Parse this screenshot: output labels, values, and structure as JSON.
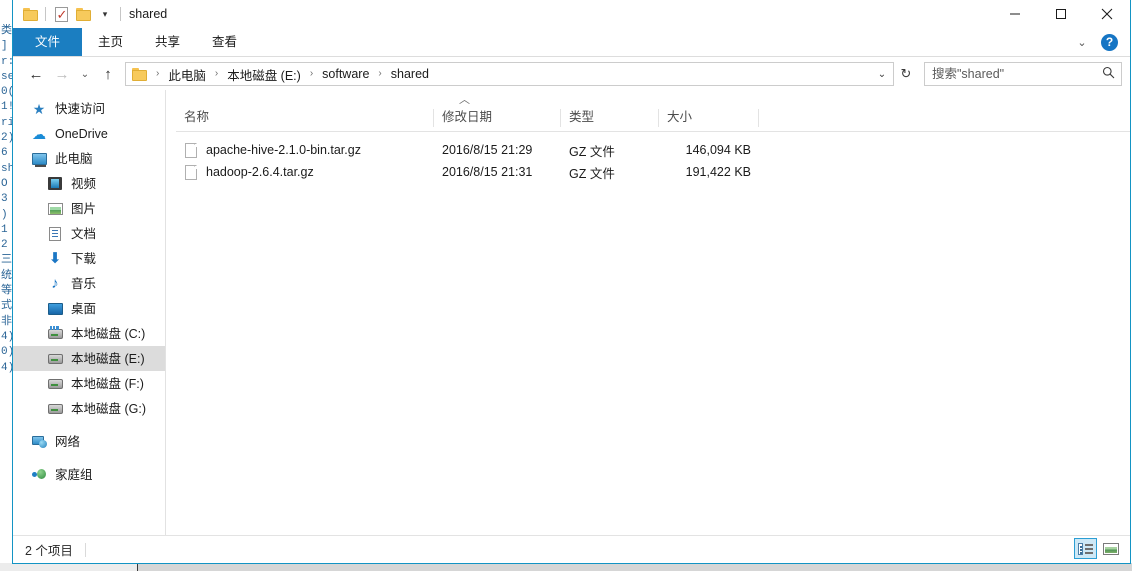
{
  "window": {
    "title": "shared",
    "quick_access": [
      {
        "name": "folder-icon",
        "label": "属性"
      },
      {
        "name": "properties-icon",
        "label": "属性"
      },
      {
        "name": "new-folder-icon",
        "label": "新建文件夹"
      }
    ],
    "controls": {
      "minimize": "—",
      "maximize": "□",
      "close": "✕"
    }
  },
  "ribbon": {
    "tabs": [
      {
        "label": "文件",
        "selected": true
      },
      {
        "label": "主页",
        "selected": false
      },
      {
        "label": "共享",
        "selected": false
      },
      {
        "label": "查看",
        "selected": false
      }
    ],
    "collapse_label": "⌄",
    "help_label": "?"
  },
  "address": {
    "back_label": "←",
    "forward_label": "→",
    "history_label": "⌄",
    "up_label": "↑",
    "crumbs": [
      "此电脑",
      "本地磁盘 (E:)",
      "software",
      "shared"
    ],
    "separator": "›",
    "dropdown_label": "⌄",
    "refresh_label": "↻"
  },
  "search": {
    "placeholder": "搜索\"shared\"",
    "value": "",
    "icon": "search-icon"
  },
  "sidebar": {
    "items": [
      {
        "label": "快速访问",
        "icon": "star-icon",
        "indent": false,
        "selected": false
      },
      {
        "label": "OneDrive",
        "icon": "cloud-icon",
        "indent": false,
        "selected": false
      },
      {
        "label": "此电脑",
        "icon": "monitor-icon",
        "indent": false,
        "selected": false
      },
      {
        "label": "视频",
        "icon": "video-icon",
        "indent": true,
        "selected": false
      },
      {
        "label": "图片",
        "icon": "picture-icon",
        "indent": true,
        "selected": false
      },
      {
        "label": "文档",
        "icon": "document-icon",
        "indent": true,
        "selected": false
      },
      {
        "label": "下载",
        "icon": "download-icon",
        "indent": true,
        "selected": false
      },
      {
        "label": "音乐",
        "icon": "music-icon",
        "indent": true,
        "selected": false
      },
      {
        "label": "桌面",
        "icon": "desktop-icon",
        "indent": true,
        "selected": false
      },
      {
        "label": "本地磁盘 (C:)",
        "icon": "system-drive-icon",
        "indent": true,
        "selected": false
      },
      {
        "label": "本地磁盘 (E:)",
        "icon": "drive-icon",
        "indent": true,
        "selected": true
      },
      {
        "label": "本地磁盘 (F:)",
        "icon": "drive-icon",
        "indent": true,
        "selected": false
      },
      {
        "label": "本地磁盘 (G:)",
        "icon": "drive-icon",
        "indent": true,
        "selected": false
      },
      {
        "label": "网络",
        "icon": "network-icon",
        "indent": false,
        "selected": false
      },
      {
        "label": "家庭组",
        "icon": "homegroup-icon",
        "indent": false,
        "selected": false
      }
    ]
  },
  "filelist": {
    "sort_indicator": "︿",
    "columns": [
      {
        "label": "名称",
        "key": "name"
      },
      {
        "label": "修改日期",
        "key": "date"
      },
      {
        "label": "类型",
        "key": "type"
      },
      {
        "label": "大小",
        "key": "size"
      }
    ],
    "rows": [
      {
        "name": "apache-hive-2.1.0-bin.tar.gz",
        "date": "2016/8/15 21:29",
        "type": "GZ 文件",
        "size": "146,094 KB",
        "icon": "file-icon"
      },
      {
        "name": "hadoop-2.6.4.tar.gz",
        "date": "2016/8/15 21:31",
        "type": "GZ 文件",
        "size": "191,422 KB",
        "icon": "file-icon"
      }
    ]
  },
  "statusbar": {
    "item_count": "2 个项目",
    "views": [
      {
        "name": "details-view",
        "label": "详细信息",
        "active": true
      },
      {
        "name": "large-icons-view",
        "label": "大图标",
        "active": false
      }
    ]
  },
  "background": {
    "left_text": "类\n]\nr:\nse\n0(\n1!\nri\n2)\n6\nsh\nO\n3\n)\n1\n2\n三\n统\n等\n式\n非\n4)\n0)\n4)",
    "colors": {
      "window_border": "#1394c4",
      "accent": "#1b7ec1",
      "selection": "#dcdcdc"
    }
  }
}
